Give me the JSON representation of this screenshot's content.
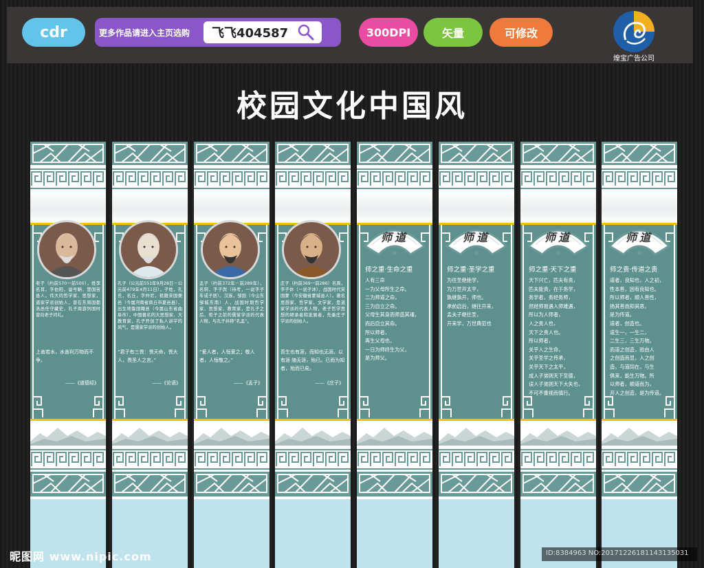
{
  "topbar": {
    "format_label": "cdr",
    "promo_text": "更多作品请进入主页选购",
    "shop_id": "飞飞404587",
    "tags": [
      "300DPI",
      "矢量",
      "可修改"
    ],
    "company": "煌宝广告公司"
  },
  "title": "校园文化中国风",
  "portrait_panels": [
    {
      "bio": "老子（约前570一前500），姓李名耳，字伯阳，谥号聃，楚国苦县人，伟大的哲学家、思想家，道家学派创始人，曾在东周国都洛邑任守藏史，孔子周游列国时曾向老子问礼。",
      "quote": "上善若水，水善利万物而不争。",
      "source": "——《道德经》"
    },
    {
      "bio": "孔子（公元前551年9月28日－公元前479年4月11日），子姓，孔氏，名丘，字仲尼，祖籍宋国栗邑（今属河南省商丘市夏邑县），出生地鲁国陬邑（今属山东省曲阜市），中国著名的大思想家、大教育家，孔子开创了私人讲学的风气，是儒家学派的创始人。",
      "quote": "“君子有三畏：畏天命，畏大人，畏圣人之言。”",
      "source": "——《论语》"
    },
    {
      "bio": "孟子（约前372年－前289年），名轲，字子舆（待考，一说字子车或子居）。汉族，邹国（今山东邹城东南）人，战国时期哲学家、思想家、教育家，是孔子之后、荀子之前的儒家学派的代表人物，与孔子并称“孔孟”。",
      "quote": "“爱人者，人恒爱之；敬人者，人恒敬之。”",
      "source": "——《孟子》"
    },
    {
      "bio": "庄子（约前369一前286）名周，字子休（一说子沐），战国时代宋国蒙（今安徽省蒙城县人）。著名思想家、哲学家、文学家，是道家学派的代表人物，老子哲学思想的继承者和发展者，先秦庄子学派的创始人。",
      "quote": "吾生也有涯，而知也无涯。以有涯 随无涯，殆已。已而为知者，殆而已矣。",
      "source": "——《庄子》"
    }
  ],
  "text_panels": [
    {
      "fan": "师道",
      "heading": "师之重·生命之重",
      "lines": [
        "人有三命",
        "一为父母所生之命。",
        "二为师道之命，",
        "三为自立之命。",
        "父母生其身而师造其魂，",
        "而后自立其命。",
        "所以师者，",
        "再生父母也，",
        "一日为师终生为父，",
        "是为师父。"
      ]
    },
    {
      "fan": "师道",
      "heading": "师之重·圣学之重",
      "lines": [
        "为往圣继绝学，",
        "为万世开太平，",
        "孰继孰开，师也。",
        "承前启后，继往开来，",
        "孟夫子继往圣，",
        "开来学，万世典范也"
      ]
    },
    {
      "fan": "师道",
      "heading": "师之重·天下之重",
      "lines": [
        "天下兴亡，匹夫有责，",
        "匹夫能责，在于务学，",
        "务学者，务经务师，",
        "然经师易遇人师难遇，",
        "所以为人师者，",
        "人之贵人也，",
        "天下之贵人也。",
        "所以师者，",
        "关乎人之生命，",
        "关乎圣学之传承，",
        "关乎天下之太平，",
        "成人子弟则天下至德，",
        "误人子弟则天下大失也，",
        "不可不重视而慎行。"
      ]
    },
    {
      "fan": "师道",
      "heading": "师之贵·传道之贵",
      "lines": [
        "道者，良知也，人之初，",
        "性本善，因有良知也。",
        "所以师者，顺人善性，",
        "扬其善而抑其恶，",
        "是为传道。",
        "道者，创造也。",
        "道生一，一生二，",
        "二生三，三生万物。",
        "而道之创造，验由人",
        "之创造而显，人之创",
        "造，与道同在，与生",
        "俱来，能生万物。所",
        "以师者，顺道而为，",
        "开人之创造，是为传道。"
      ]
    }
  ],
  "footer": {
    "watermark": "昵图网 www.nipic.com",
    "id_line": "ID:8384963 NO:20171226181143135031"
  }
}
